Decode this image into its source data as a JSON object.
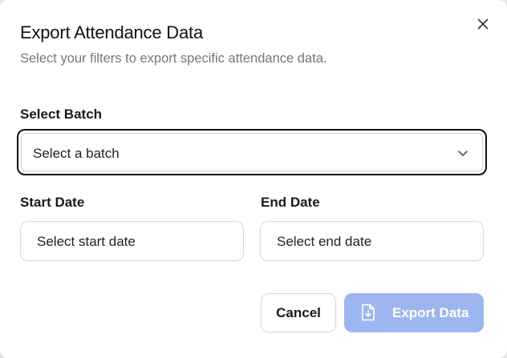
{
  "dialog": {
    "title": "Export Attendance Data",
    "subtitle": "Select your filters to export specific attendance data.",
    "close_icon": "close-icon"
  },
  "batch": {
    "label": "Select Batch",
    "placeholder": "Select a batch",
    "icon": "chevron-down-icon"
  },
  "start_date": {
    "label": "Start Date",
    "placeholder": "Select start date"
  },
  "end_date": {
    "label": "End Date",
    "placeholder": "Select end date"
  },
  "actions": {
    "cancel_label": "Cancel",
    "export_label": "Export Data",
    "export_icon": "file-download-icon",
    "export_color": "#9db6ef"
  }
}
